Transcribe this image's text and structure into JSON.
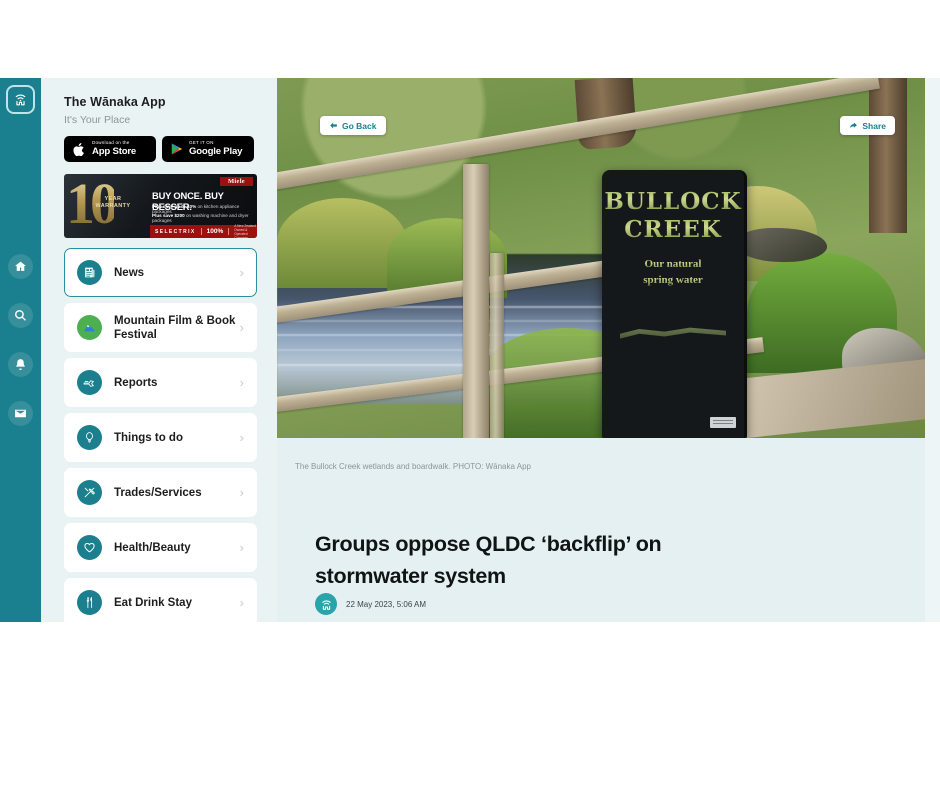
{
  "rail": {
    "logo_icon": "wanaka-app-logo",
    "items": [
      {
        "name": "home",
        "icon": "home-icon"
      },
      {
        "name": "search",
        "icon": "search-icon"
      },
      {
        "name": "notifications",
        "icon": "bell-icon"
      },
      {
        "name": "messages",
        "icon": "mail-icon"
      }
    ]
  },
  "sidebar": {
    "title": "The Wānaka App",
    "subtitle": "It's Your Place",
    "store_badges": [
      {
        "small": "Download on the",
        "big": "App Store",
        "icon": "apple-icon"
      },
      {
        "small": "GET IT ON",
        "big": "Google Play",
        "icon": "google-play-icon"
      }
    ],
    "ad": {
      "number": "10",
      "warranty_line1": "YEAR",
      "warranty_line2": "WARRANTY",
      "brand": "Miele",
      "tagline": "BUY ONCE. BUY BESSER.",
      "offer1_bold": "Plus save up to 10%",
      "offer1_rest": " on kitchen appliance packages",
      "offer2_bold": "Plus save $200",
      "offer2_rest": " on washing machine and dryer packages",
      "retailer": "SELECTRIX",
      "retailer_mark": "100%",
      "retailer_note": "A New Zealand Owned & Operated Company"
    },
    "menu": [
      {
        "label": "News",
        "icon": "newspaper-icon",
        "active": true,
        "color": "teal"
      },
      {
        "label": "Mountain Film & Book Festival",
        "icon": "mountain-icon",
        "active": false,
        "color": "green"
      },
      {
        "label": "Reports",
        "icon": "plane-icon",
        "active": false,
        "color": "teal"
      },
      {
        "label": "Things to do",
        "icon": "balloon-icon",
        "active": false,
        "color": "teal"
      },
      {
        "label": "Trades/Services",
        "icon": "tools-icon",
        "active": false,
        "color": "teal"
      },
      {
        "label": "Health/Beauty",
        "icon": "heart-icon",
        "active": false,
        "color": "teal"
      },
      {
        "label": "Eat Drink Stay",
        "icon": "cutlery-icon",
        "active": false,
        "color": "teal"
      }
    ],
    "chevron": "›"
  },
  "article": {
    "go_back_label": "Go Back",
    "share_label": "Share",
    "hero_sign": {
      "line1": "BULLOCK",
      "line2": "CREEK",
      "line3": "Our natural",
      "line4": "spring water"
    },
    "caption": "The Bullock Creek wetlands and boardwalk. PHOTO: Wānaka App",
    "headline": "Groups oppose QLDC ‘backflip’ on stormwater system",
    "date": "22 May 2023, 5:06 AM",
    "avatar_icon": "wanaka-app-avatar"
  },
  "colors": {
    "teal": "#1a7f8e",
    "teal_accent": "#2a8f9e",
    "page_bg": "#eef5f6",
    "sidebar_bg": "#eaf3f4",
    "content_bg": "#e4f0f1",
    "green": "#4caf50"
  }
}
